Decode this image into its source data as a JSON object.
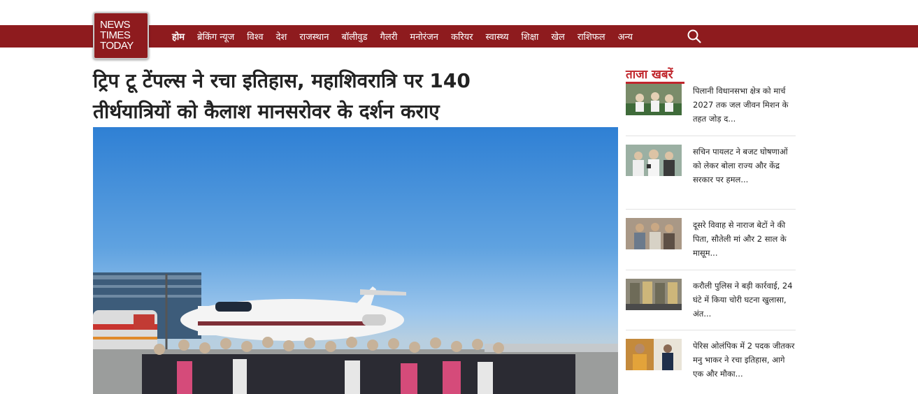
{
  "brand": {
    "logo_lines": [
      "NEWS",
      "TIMES",
      "TODAY"
    ]
  },
  "nav": {
    "items": [
      {
        "label": "होम",
        "active": true
      },
      {
        "label": "ब्रेकिंग न्यूज",
        "active": false
      },
      {
        "label": "विश्व",
        "active": false
      },
      {
        "label": "देश",
        "active": false
      },
      {
        "label": "राजस्थान",
        "active": false
      },
      {
        "label": "बॉलीवुड",
        "active": false
      },
      {
        "label": "गैलरी",
        "active": false
      },
      {
        "label": "मनोरंजन",
        "active": false
      },
      {
        "label": "करियर",
        "active": false
      },
      {
        "label": "स्वास्थ्य",
        "active": false
      },
      {
        "label": "शिक्षा",
        "active": false
      },
      {
        "label": "खेल",
        "active": false
      },
      {
        "label": "राशिफल",
        "active": false
      },
      {
        "label": "अन्य",
        "active": false
      }
    ],
    "search_icon": "search-icon"
  },
  "article": {
    "headline_line1": "ट्रिप टू टेंपल्स ने रचा इतिहास, महाशिवरात्रि पर 140",
    "headline_line2": "तीर्थयात्रियों को कैलाश मानसरोवर के दर्शन कराए"
  },
  "sidebar": {
    "title": "ताजा खबरें",
    "items": [
      {
        "text": "पिलानी विधानसभा क्षेत्र को मार्च 2027 तक जल जीवन मिशन के तहत जोड़ द..."
      },
      {
        "text": "सचिन पायलट ने बजट घोषणाओं को लेकर बोला राज्य और केंद्र सरकार पर हमल..."
      },
      {
        "text": "दूसरे विवाह से नाराज बेटों ने की पिता, सौतेली मां और 2 साल के मासूम..."
      },
      {
        "text": "करौली पुलिस ने बड़ी कार्रवाई, 24 घंटे में किया चोरी घटना खुलासा, अंत..."
      },
      {
        "text": "पेरिस ओलंपिक में 2 पदक जीतकर मनु भाकर ने रचा इतिहास, आगे एक और मौका..."
      }
    ]
  },
  "colors": {
    "nav_bg": "#8e1b1e",
    "accent_red": "#c0262c"
  }
}
